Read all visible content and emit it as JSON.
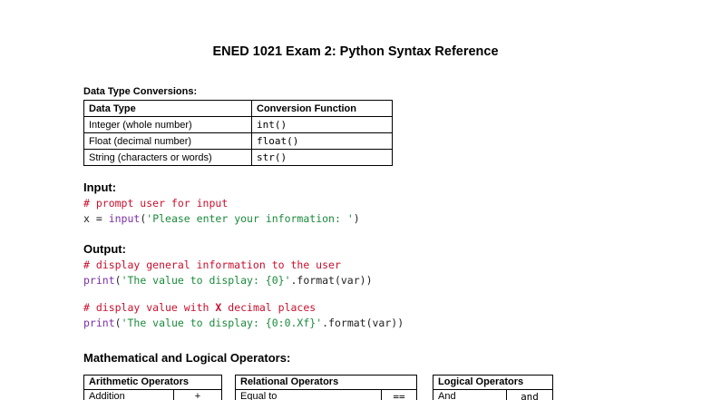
{
  "title": "ENED 1021 Exam 2: Python Syntax Reference",
  "conversions": {
    "heading": "Data Type Conversions:",
    "col1": "Data Type",
    "col2": "Conversion Function",
    "rows": [
      {
        "type": "Integer (whole number)",
        "fn": "int()"
      },
      {
        "type": "Float (decimal number)",
        "fn": "float()"
      },
      {
        "type": "String (characters or words)",
        "fn": "str()"
      }
    ]
  },
  "input": {
    "heading": "Input:",
    "comment": "# prompt user for input",
    "code_var": "x = ",
    "code_fn": "input",
    "code_open": "(",
    "code_str": "'Please enter your information: '",
    "code_close": ")"
  },
  "output": {
    "heading": "Output:",
    "comment1": "# display general information to the user",
    "fn1": "print",
    "open1": "(",
    "str1": "'The value to display: {0}'",
    "rest1": ".format(var))",
    "comment2_a": "# display value with ",
    "comment2_x": "X",
    "comment2_b": " decimal places",
    "fn2": "print",
    "open2": "(",
    "str2": "'The value to display: {0:0.Xf}'",
    "rest2": ".format(var))"
  },
  "operators": {
    "heading": "Mathematical and Logical Operators:",
    "arith": {
      "header": "Arithmetic Operators",
      "row1_label": "Addition",
      "row1_sym": "+"
    },
    "relational": {
      "header": "Relational Operators",
      "row1_label": "Equal to",
      "row1_sym": "=="
    },
    "logical": {
      "header": "Logical Operators",
      "row1_label": "And",
      "row1_sym": "and"
    }
  }
}
